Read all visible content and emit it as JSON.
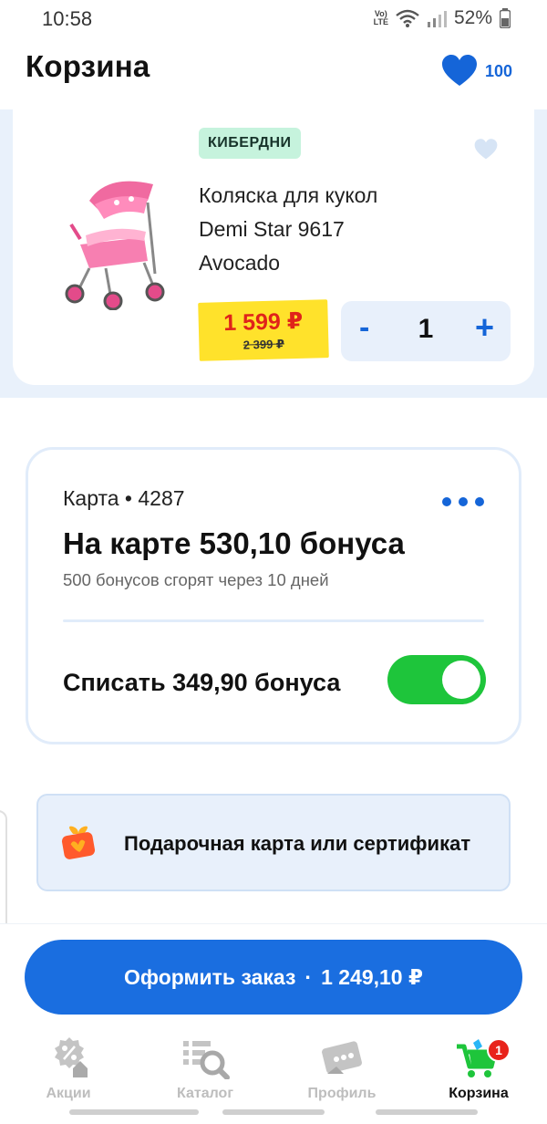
{
  "status_bar": {
    "time": "10:58",
    "network_top": "Vo)",
    "network_bottom": "LTE",
    "battery": "52%"
  },
  "header": {
    "title": "Корзина",
    "favorites_count": "100",
    "accent_color": "#1565d8"
  },
  "cart_item": {
    "badge": "КИБЕРДНИ",
    "name_line1": "Коляска для кукол",
    "name_line2": "Demi Star 9617",
    "name_line3": "Avocado",
    "price_new": "1 599 ₽",
    "price_old": "2 399 ₽",
    "qty_minus": "-",
    "qty_value": "1",
    "qty_plus": "+"
  },
  "bonus_card": {
    "card_label": "Карта • 4287",
    "balance": "На карте 530,10 бонуса",
    "expire_note": "500 бонусов сгорят через 10 дней",
    "redeem_label": "Списать 349,90 бонуса",
    "redeem_enabled": true,
    "toggle_color": "#1ec53b"
  },
  "gift": {
    "label": "Подарочная карта или сертификат"
  },
  "checkout": {
    "label": "Оформить заказ",
    "separator": "·",
    "total": "1 249,10 ₽",
    "button_color": "#1a6ee0"
  },
  "tab_bar": {
    "tabs": [
      {
        "label": "Акции",
        "icon": "percent-icon",
        "active": false
      },
      {
        "label": "Каталог",
        "icon": "catalog-search-icon",
        "active": false
      },
      {
        "label": "Профиль",
        "icon": "profile-card-icon",
        "active": false
      },
      {
        "label": "Корзина",
        "icon": "cart-icon",
        "active": true,
        "badge": "1"
      }
    ]
  }
}
